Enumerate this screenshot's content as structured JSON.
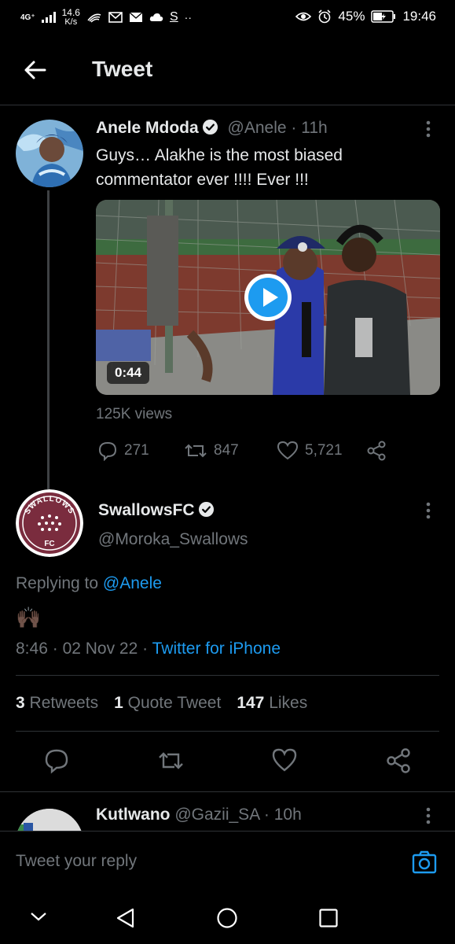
{
  "status_bar": {
    "network": "4G⁺",
    "speed": "14.6",
    "speed_unit": "K/s",
    "battery": "45%",
    "time": "19:46"
  },
  "header": {
    "title": "Tweet"
  },
  "main_tweet": {
    "author_name": "Anele Mdoda",
    "handle": "@Anele",
    "time": "11h",
    "separator": "·",
    "text": "Guys… Alakhe is the most biased commentator ever !!!! Ever !!!",
    "video_duration": "0:44",
    "views": "125K views",
    "replies": "271",
    "retweets": "847",
    "likes": "5,721"
  },
  "reply_tweet": {
    "author_name": "SwallowsFC",
    "handle": "@Moroka_Swallows",
    "avatar_text_top": "SWALLOWS",
    "avatar_text_bottom": "FC",
    "replying_prefix": "Replying to",
    "replying_to": "@Anele",
    "content_emoji": "🙌🏿",
    "time": "8:46",
    "date": "02 Nov 22",
    "separator": "·",
    "source": "Twitter for iPhone",
    "retweets_count": "3",
    "retweets_label": "Retweets",
    "quotes_count": "1",
    "quotes_label": "Quote Tweet",
    "likes_count": "147",
    "likes_label": "Likes"
  },
  "next_tweet": {
    "author_name": "Kutlwano",
    "handle": "@Gazii_SA",
    "separator": "·",
    "time": "10h"
  },
  "reply_bar": {
    "placeholder": "Tweet your reply"
  },
  "colors": {
    "background": "#000000",
    "accent": "#1d9bf0",
    "muted": "#71767b",
    "divider": "#2f3336",
    "swallows_maroon": "#7a2c3e"
  }
}
